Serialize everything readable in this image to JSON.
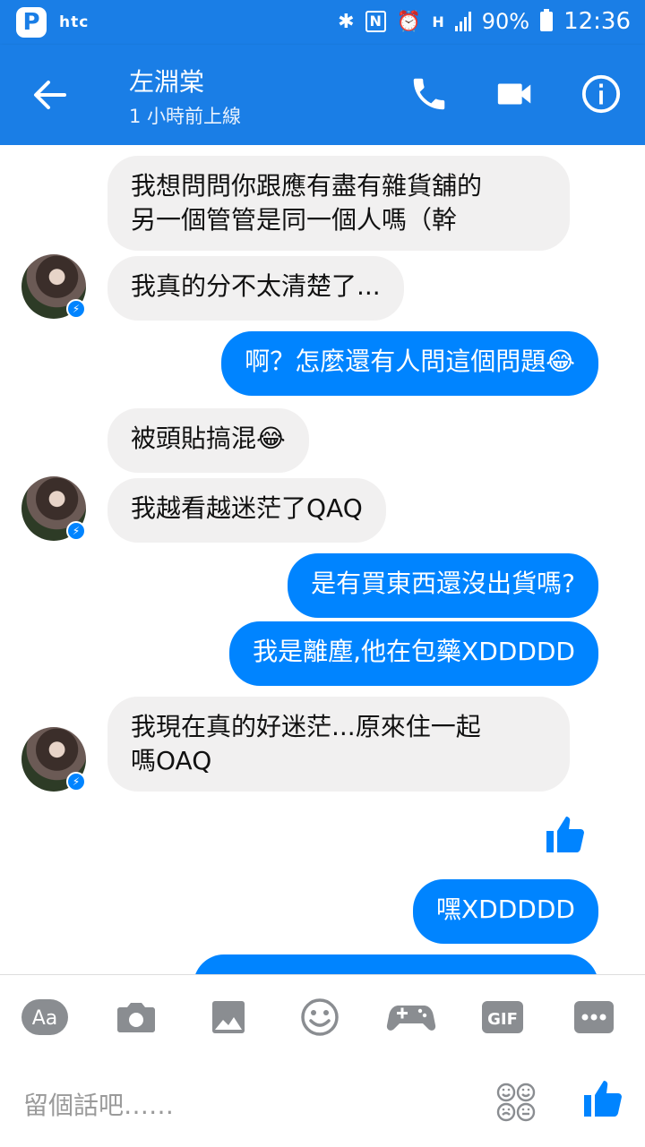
{
  "status_bar": {
    "carrier": "htc",
    "app_badge": "P",
    "nfc": "N",
    "network": "H",
    "battery": "90%",
    "time": "12:36"
  },
  "header": {
    "name": "左淵棠",
    "subtitle": "1 小時前上線",
    "icons": [
      "back-arrow-icon",
      "phone-icon",
      "video-icon",
      "info-icon"
    ]
  },
  "messages": [
    {
      "side": "in",
      "lines": [
        "我想問問你跟應有盡有雜貨舖的",
        "另一個管管是同一個人嗎（幹"
      ]
    },
    {
      "side": "in",
      "lines": [
        "我真的分不太清楚了..."
      ]
    },
    {
      "side": "out",
      "lines": [
        "啊？怎麼還有人問這個問題😂"
      ]
    },
    {
      "side": "in",
      "lines": [
        "被頭貼搞混😂"
      ]
    },
    {
      "side": "in",
      "lines": [
        "我越看越迷茫了QAQ"
      ]
    },
    {
      "side": "out",
      "lines": [
        "是有買東西還沒出貨嗎?"
      ]
    },
    {
      "side": "out",
      "lines": [
        "我是離塵,他在包藥XDDDDD"
      ]
    },
    {
      "side": "in",
      "lines": [
        "我現在真的好迷茫...原來住一起",
        "嗎OAQ"
      ]
    },
    {
      "side": "out",
      "lines": [
        "嘿XDDDDD"
      ]
    }
  ],
  "composer": {
    "aa_label": "Aa",
    "gif_label": "GIF",
    "placeholder": "留個話吧……",
    "tools": [
      "text-format-icon",
      "camera-icon",
      "image-icon",
      "emoji-icon",
      "game-icon",
      "gif-icon",
      "more-icon"
    ]
  },
  "colors": {
    "header": "#1a7ee6",
    "outgoing_bubble": "#0084ff",
    "incoming_bubble": "#f1f0f0"
  }
}
